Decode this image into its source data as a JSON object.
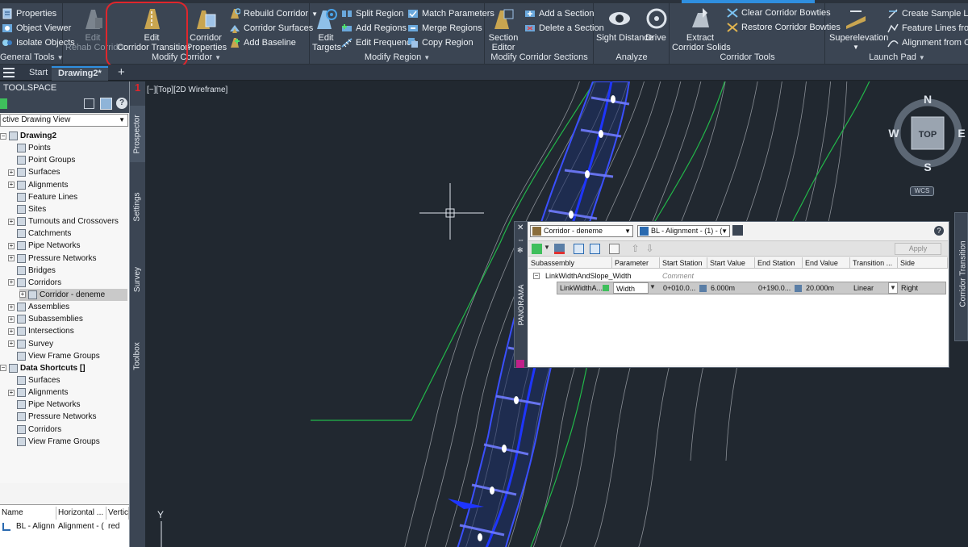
{
  "ribbon": {
    "general_tools": {
      "title": "General Tools",
      "properties": "Properties",
      "object_viewer": "Object Viewer",
      "isolate_objects": "Isolate Objects"
    },
    "modify_corridor": {
      "title": "Modify Corridor",
      "edit_rehab_line1": "Edit",
      "edit_rehab_line2": "Rehab Corridor",
      "edit_transition_line1": "Edit",
      "edit_transition_line2": "Corridor Transition",
      "corridor_properties_line1": "Corridor",
      "corridor_properties_line2": "Properties",
      "rebuild_corridor": "Rebuild Corridor",
      "corridor_surfaces": "Corridor Surfaces",
      "add_baseline": "Add Baseline"
    },
    "modify_region": {
      "title": "Modify Region",
      "edit_targets_line1": "Edit",
      "edit_targets_line2": "Targets",
      "split_region": "Split Region",
      "add_regions": "Add Regions",
      "edit_frequency": "Edit Frequency",
      "match_parameters": "Match Parameters",
      "merge_regions": "Merge Regions",
      "copy_region": "Copy Region"
    },
    "modify_sections": {
      "title": "Modify Corridor Sections",
      "section_editor_line1": "Section",
      "section_editor_line2": "Editor",
      "add_section": "Add a Section",
      "delete_section": "Delete a Section"
    },
    "analyze": {
      "title": "Analyze",
      "sight_distance": "Sight Distance",
      "drive": "Drive"
    },
    "corridor_tools": {
      "title": "Corridor Tools",
      "extract_line1": "Extract",
      "extract_line2": "Corridor Solids",
      "clear_bowties": "Clear Corridor Bowties",
      "restore_bowties": "Restore Corridor Bowties"
    },
    "launch_pad": {
      "title": "Launch Pad",
      "superelevation": "Superelevation",
      "create_sample_lines": "Create Sample Lines",
      "feature_lines_from": "Feature Lines from C",
      "alignment_from": "Alignment from Cor"
    }
  },
  "tabs": {
    "start": "Start",
    "drawing": "Drawing2*",
    "plus": "+"
  },
  "toolspace": {
    "title": "TOOLSPACE",
    "view_selector": "ctive Drawing View",
    "tree": [
      "Drawing2",
      "Points",
      "Point Groups",
      "Surfaces",
      "Alignments",
      "Feature Lines",
      "Sites",
      "Turnouts and Crossovers",
      "Catchments",
      "Pipe Networks",
      "Pressure Networks",
      "Bridges",
      "Corridors",
      "Corridor - deneme",
      "Assemblies",
      "Subassemblies",
      "Intersections",
      "Survey",
      "View Frame Groups",
      "Data Shortcuts []",
      "Surfaces",
      "Alignments",
      "Pipe Networks",
      "Pressure Networks",
      "Corridors",
      "View Frame Groups"
    ],
    "table_headers": [
      "Name",
      "Horizontal ...",
      "Vertica"
    ],
    "table_row": [
      "BL - Alignn",
      "Alignment - (",
      "red"
    ]
  },
  "side_tabs": {
    "prospector": "Prospector",
    "settings": "Settings",
    "survey": "Survey",
    "toolbox": "Toolbox"
  },
  "viewport": {
    "label": "[−][Top][2D Wireframe]",
    "number": "1",
    "axis_y": "Y",
    "compass_n": "N",
    "compass_s": "S",
    "compass_e": "E",
    "compass_w": "W",
    "top": "TOP",
    "wcs": "WCS"
  },
  "corridor_transition_tab": "Corridor Transition",
  "panorama": {
    "side_label": "PANORAMA",
    "corridor_select": "Corridor - deneme",
    "baseline_select": "BL - Alignment - (1) - (",
    "apply": "Apply",
    "help": "?",
    "columns": [
      "Subassembly",
      "Parameter",
      "Start Station",
      "Start Value",
      "End Station",
      "End Value",
      "Transition ...",
      "Side"
    ],
    "group_row": {
      "subassembly": "LinkWidthAndSlope_Width",
      "comment": "Comment"
    },
    "data_row": {
      "subassembly": "LinkWidthA...",
      "parameter": "Width",
      "start_station": "0+010.0...",
      "start_value": "6.000m",
      "end_station": "0+190.0...",
      "end_value": "20.000m",
      "transition": "Linear",
      "side": "Right"
    }
  },
  "colors": {
    "accent": "#2f8fe0",
    "highlight": "#e0262c",
    "corridor": "#3a4fff",
    "boundary": "#22b84a",
    "contour": "#8a8a8a"
  }
}
